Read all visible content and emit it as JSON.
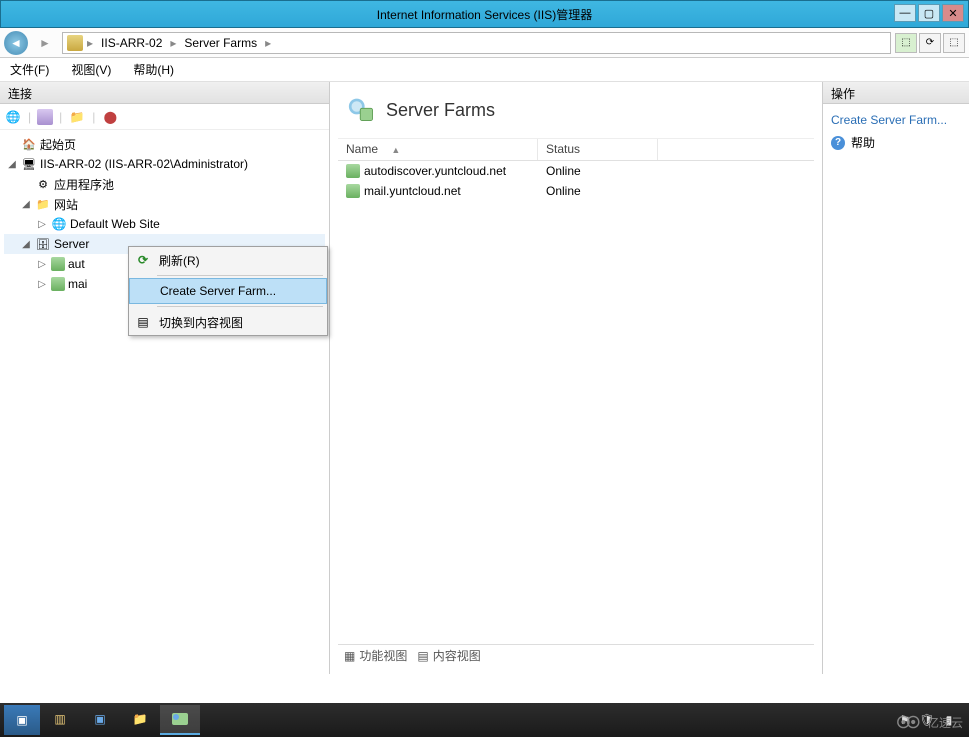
{
  "window": {
    "title": "Internet Information Services (IIS)管理器"
  },
  "breadcrumb": {
    "root_icon": "iis-icon",
    "parts": [
      "IIS-ARR-02",
      "Server Farms"
    ]
  },
  "menubar": {
    "file": "文件(F)",
    "view": "视图(V)",
    "help": "帮助(H)"
  },
  "left_panel": {
    "header": "连接",
    "tree": {
      "start_page": "起始页",
      "server": "IIS-ARR-02 (IIS-ARR-02\\Administrator)",
      "app_pools": "应用程序池",
      "sites": "网站",
      "default_site": "Default Web Site",
      "server_farms": "Server",
      "farm_auto_short": "aut",
      "farm_mail_short": "mai"
    }
  },
  "context_menu": {
    "refresh": "刷新(R)",
    "create": "Create Server Farm...",
    "switch_view": "切换到内容视图"
  },
  "center": {
    "title": "Server Farms",
    "columns": {
      "name": "Name",
      "status": "Status"
    },
    "rows": [
      {
        "name": "autodiscover.yuntcloud.net",
        "status": "Online"
      },
      {
        "name": "mail.yuntcloud.net",
        "status": "Online"
      }
    ],
    "tabs": {
      "features": "功能视图",
      "content": "内容视图"
    }
  },
  "right_panel": {
    "header": "操作",
    "create_link": "Create Server Farm...",
    "help": "帮助"
  },
  "watermark": "亿速云"
}
